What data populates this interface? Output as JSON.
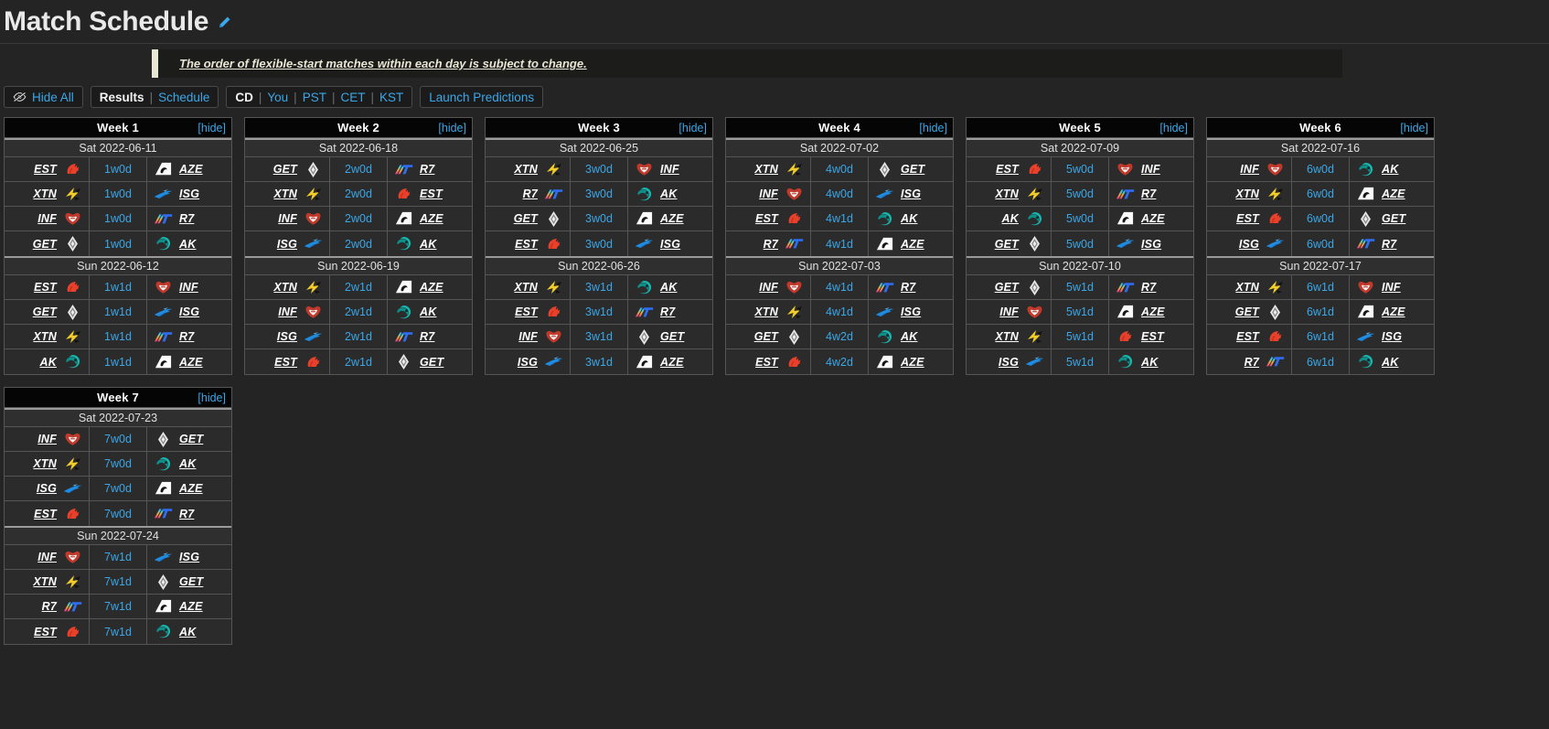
{
  "header": {
    "title": "Match Schedule",
    "edit_icon": "pencil-icon"
  },
  "notice": {
    "text": "The order of flexible-start matches within each day is subject to change."
  },
  "toolbar": {
    "hide_all": {
      "icon": "eye-slash-icon",
      "label": "Hide All"
    },
    "view": {
      "selected": "Results",
      "other": "Schedule",
      "separator": "|"
    },
    "timezones": {
      "selected": "CD",
      "options": [
        "You",
        "PST",
        "CET",
        "KST"
      ],
      "separator": "|"
    },
    "predictions": {
      "label": "Launch Predictions"
    }
  },
  "hide_label": "[hide]",
  "teams": {
    "EST": {
      "abbr": "EST",
      "logo": "est-logo"
    },
    "XTN": {
      "abbr": "XTN",
      "logo": "xtn-logo"
    },
    "INF": {
      "abbr": "INF",
      "logo": "inf-logo"
    },
    "GET": {
      "abbr": "GET",
      "logo": "get-logo"
    },
    "AZE": {
      "abbr": "AZE",
      "logo": "aze-logo"
    },
    "ISG": {
      "abbr": "ISG",
      "logo": "isg-logo"
    },
    "R7": {
      "abbr": "R7",
      "logo": "r7-logo"
    },
    "AK": {
      "abbr": "AK",
      "logo": "ak-logo"
    }
  },
  "weeks": [
    {
      "title": "Week 1",
      "days": [
        {
          "date": "Sat 2022-06-11",
          "matches": [
            {
              "left": "EST",
              "time": "1w0d",
              "right": "AZE"
            },
            {
              "left": "XTN",
              "time": "1w0d",
              "right": "ISG"
            },
            {
              "left": "INF",
              "time": "1w0d",
              "right": "R7"
            },
            {
              "left": "GET",
              "time": "1w0d",
              "right": "AK"
            }
          ]
        },
        {
          "date": "Sun 2022-06-12",
          "matches": [
            {
              "left": "EST",
              "time": "1w1d",
              "right": "INF"
            },
            {
              "left": "GET",
              "time": "1w1d",
              "right": "ISG"
            },
            {
              "left": "XTN",
              "time": "1w1d",
              "right": "R7"
            },
            {
              "left": "AK",
              "time": "1w1d",
              "right": "AZE"
            }
          ]
        }
      ]
    },
    {
      "title": "Week 2",
      "days": [
        {
          "date": "Sat 2022-06-18",
          "matches": [
            {
              "left": "GET",
              "time": "2w0d",
              "right": "R7"
            },
            {
              "left": "XTN",
              "time": "2w0d",
              "right": "EST"
            },
            {
              "left": "INF",
              "time": "2w0d",
              "right": "AZE"
            },
            {
              "left": "ISG",
              "time": "2w0d",
              "right": "AK"
            }
          ]
        },
        {
          "date": "Sun 2022-06-19",
          "matches": [
            {
              "left": "XTN",
              "time": "2w1d",
              "right": "AZE"
            },
            {
              "left": "INF",
              "time": "2w1d",
              "right": "AK"
            },
            {
              "left": "ISG",
              "time": "2w1d",
              "right": "R7"
            },
            {
              "left": "EST",
              "time": "2w1d",
              "right": "GET"
            }
          ]
        }
      ]
    },
    {
      "title": "Week 3",
      "days": [
        {
          "date": "Sat 2022-06-25",
          "matches": [
            {
              "left": "XTN",
              "time": "3w0d",
              "right": "INF"
            },
            {
              "left": "R7",
              "time": "3w0d",
              "right": "AK"
            },
            {
              "left": "GET",
              "time": "3w0d",
              "right": "AZE"
            },
            {
              "left": "EST",
              "time": "3w0d",
              "right": "ISG"
            }
          ]
        },
        {
          "date": "Sun 2022-06-26",
          "matches": [
            {
              "left": "XTN",
              "time": "3w1d",
              "right": "AK"
            },
            {
              "left": "EST",
              "time": "3w1d",
              "right": "R7"
            },
            {
              "left": "INF",
              "time": "3w1d",
              "right": "GET"
            },
            {
              "left": "ISG",
              "time": "3w1d",
              "right": "AZE"
            }
          ]
        }
      ]
    },
    {
      "title": "Week 4",
      "days": [
        {
          "date": "Sat 2022-07-02",
          "matches": [
            {
              "left": "XTN",
              "time": "4w0d",
              "right": "GET"
            },
            {
              "left": "INF",
              "time": "4w0d",
              "right": "ISG"
            },
            {
              "left": "EST",
              "time": "4w1d",
              "right": "AK"
            },
            {
              "left": "R7",
              "time": "4w1d",
              "right": "AZE"
            }
          ]
        },
        {
          "date": "Sun 2022-07-03",
          "matches": [
            {
              "left": "INF",
              "time": "4w1d",
              "right": "R7"
            },
            {
              "left": "XTN",
              "time": "4w1d",
              "right": "ISG"
            },
            {
              "left": "GET",
              "time": "4w2d",
              "right": "AK"
            },
            {
              "left": "EST",
              "time": "4w2d",
              "right": "AZE"
            }
          ]
        }
      ]
    },
    {
      "title": "Week 5",
      "days": [
        {
          "date": "Sat 2022-07-09",
          "matches": [
            {
              "left": "EST",
              "time": "5w0d",
              "right": "INF"
            },
            {
              "left": "XTN",
              "time": "5w0d",
              "right": "R7"
            },
            {
              "left": "AK",
              "time": "5w0d",
              "right": "AZE"
            },
            {
              "left": "GET",
              "time": "5w0d",
              "right": "ISG"
            }
          ]
        },
        {
          "date": "Sun 2022-07-10",
          "matches": [
            {
              "left": "GET",
              "time": "5w1d",
              "right": "R7"
            },
            {
              "left": "INF",
              "time": "5w1d",
              "right": "AZE"
            },
            {
              "left": "XTN",
              "time": "5w1d",
              "right": "EST"
            },
            {
              "left": "ISG",
              "time": "5w1d",
              "right": "AK"
            }
          ]
        }
      ]
    },
    {
      "title": "Week 6",
      "days": [
        {
          "date": "Sat 2022-07-16",
          "matches": [
            {
              "left": "INF",
              "time": "6w0d",
              "right": "AK"
            },
            {
              "left": "XTN",
              "time": "6w0d",
              "right": "AZE"
            },
            {
              "left": "EST",
              "time": "6w0d",
              "right": "GET"
            },
            {
              "left": "ISG",
              "time": "6w0d",
              "right": "R7"
            }
          ]
        },
        {
          "date": "Sun 2022-07-17",
          "matches": [
            {
              "left": "XTN",
              "time": "6w1d",
              "right": "INF"
            },
            {
              "left": "GET",
              "time": "6w1d",
              "right": "AZE"
            },
            {
              "left": "EST",
              "time": "6w1d",
              "right": "ISG"
            },
            {
              "left": "R7",
              "time": "6w1d",
              "right": "AK"
            }
          ]
        }
      ]
    },
    {
      "title": "Week 7",
      "days": [
        {
          "date": "Sat 2022-07-23",
          "matches": [
            {
              "left": "INF",
              "time": "7w0d",
              "right": "GET"
            },
            {
              "left": "XTN",
              "time": "7w0d",
              "right": "AK"
            },
            {
              "left": "ISG",
              "time": "7w0d",
              "right": "AZE"
            },
            {
              "left": "EST",
              "time": "7w0d",
              "right": "R7"
            }
          ]
        },
        {
          "date": "Sun 2022-07-24",
          "matches": [
            {
              "left": "INF",
              "time": "7w1d",
              "right": "ISG"
            },
            {
              "left": "XTN",
              "time": "7w1d",
              "right": "GET"
            },
            {
              "left": "R7",
              "time": "7w1d",
              "right": "AZE"
            },
            {
              "left": "EST",
              "time": "7w1d",
              "right": "AK"
            }
          ]
        }
      ]
    }
  ]
}
